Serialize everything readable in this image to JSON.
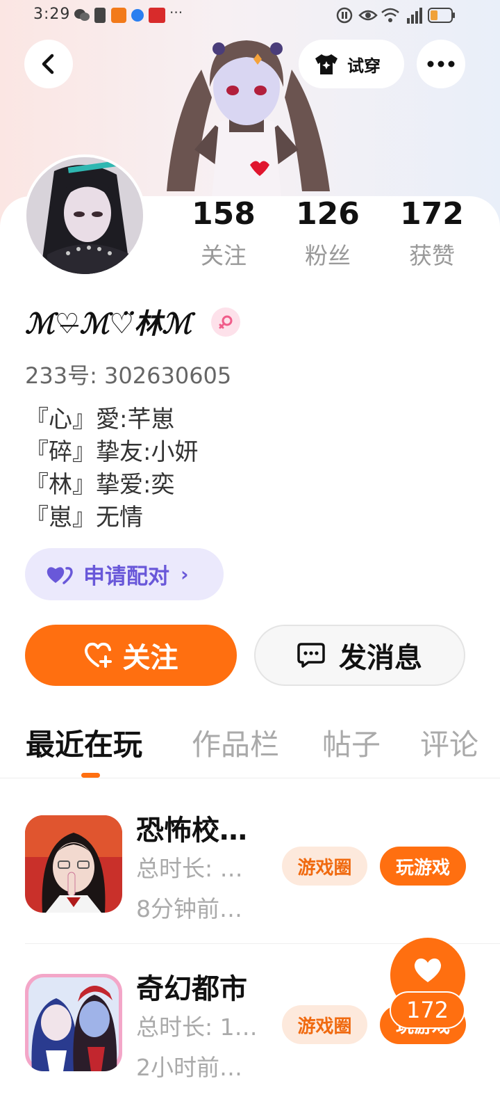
{
  "status_bar": {
    "time": "3:29",
    "more": "···"
  },
  "header": {
    "tryon_label": "试穿"
  },
  "stats": [
    {
      "count": "158",
      "label": "关注"
    },
    {
      "count": "126",
      "label": "粉丝"
    },
    {
      "count": "172",
      "label": "获赞"
    }
  ],
  "profile": {
    "name": "ℳ♡̶ℳ♡̈林ℳ",
    "user_id": "233号: 302630605",
    "bio": [
      "『心』愛:芊崽",
      "『碎』挚友:小妍",
      "『林』挚爱:奕",
      "『崽』无情"
    ]
  },
  "actions": {
    "pair_label": "申请配对",
    "follow_label": "关注",
    "message_label": "发消息"
  },
  "tabs": [
    "最近在玩",
    "作品栏",
    "帖子",
    "评论"
  ],
  "games": [
    {
      "title": "恐怖校…",
      "duration": "总时长: …",
      "last_played": "8分钟前…",
      "circle_label": "游戏圈",
      "play_label": "玩游戏"
    },
    {
      "title": "奇幻都市",
      "duration": "总时长: 1…",
      "last_played": "2小时前…",
      "circle_label": "游戏圈",
      "play_label": "玩游戏"
    }
  ],
  "floating_like": {
    "count": "172"
  },
  "colors": {
    "accent": "#ff6f10",
    "pair_text": "#6958d9",
    "pair_bg": "#ebe9fc",
    "muted": "#999999"
  }
}
